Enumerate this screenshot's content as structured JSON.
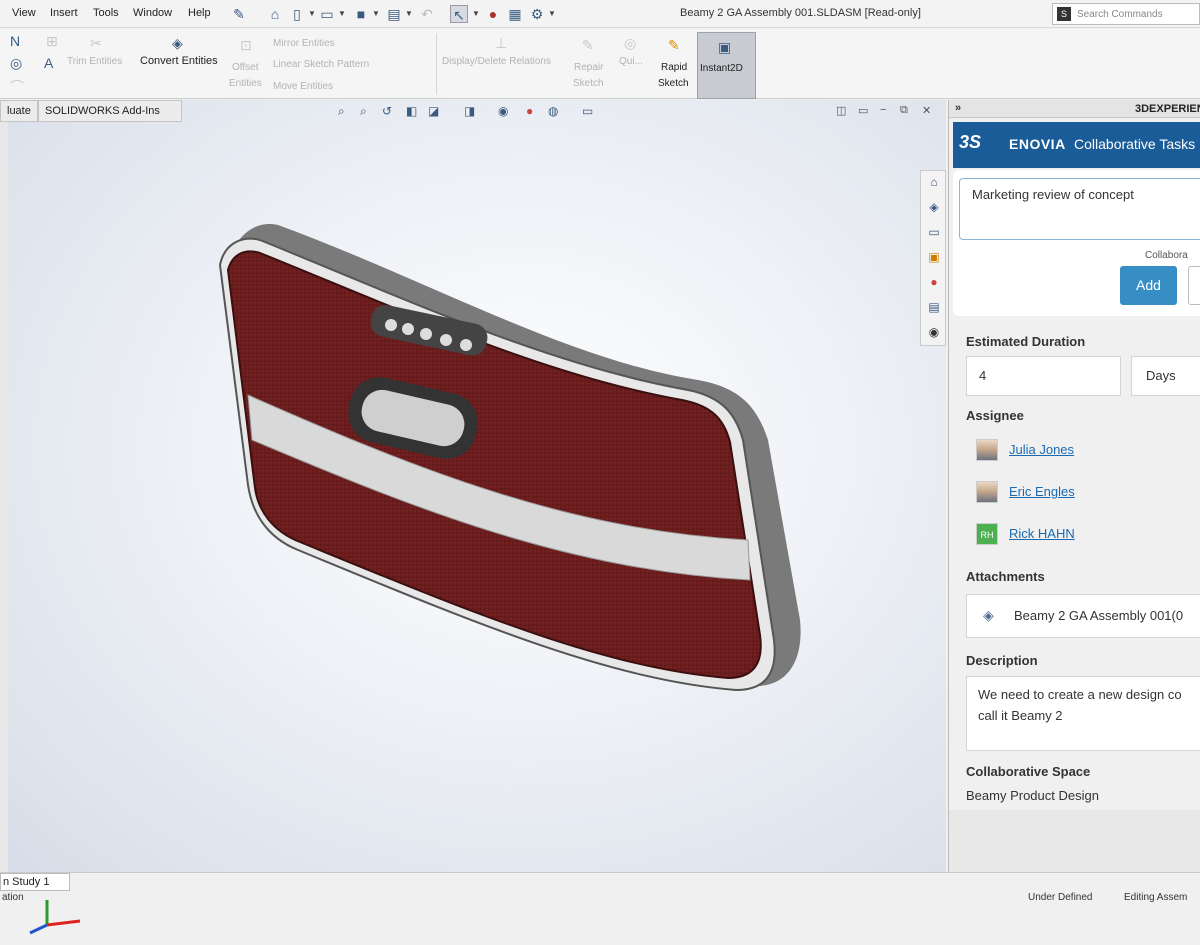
{
  "menubar": {
    "items": [
      "View",
      "Insert",
      "Tools",
      "Window",
      "Help"
    ],
    "document_title": "Beamy 2 GA Assembly 001.SLDASM [Read-only]",
    "search_placeholder": "Search Commands"
  },
  "ribbon": {
    "trim": "Trim Entities",
    "convert": "Convert Entities",
    "offset_1": "Offset",
    "offset_2": "Entities",
    "mirror": "Mirror Entities",
    "linear_pattern": "Linear Sketch Pattern",
    "move": "Move Entities",
    "display_delete": "Display/Delete Relations",
    "repair_1": "Repair",
    "repair_2": "Sketch",
    "quick": "Qui...",
    "rapid_1": "Rapid",
    "rapid_2": "Sketch",
    "instant2d": "Instant2D"
  },
  "tabs": [
    "luate",
    "SOLIDWORKS Add-Ins"
  ],
  "status": {
    "study_tab": "n Study 1",
    "left_text": "ation",
    "under_defined": "Under Defined",
    "editing": "Editing Assem"
  },
  "panel": {
    "header": "3DEXPERIEN",
    "brand": "ENOVIA",
    "app_name": "Collaborative Tasks",
    "task_title": "Marketing review of concept",
    "collab_label": "Collabora",
    "add_label": "Add",
    "duration_label": "Estimated Duration",
    "duration_value": "4",
    "duration_unit": "Days",
    "assignee_label": "Assignee",
    "assignees": [
      "Julia Jones",
      "Eric Engles",
      "Rick HAHN"
    ],
    "rh_initials": "RH",
    "attachments_label": "Attachments",
    "attachment_name": "Beamy 2 GA Assembly 001(0",
    "description_label": "Description",
    "description": "We need to create a new design co call it Beamy 2",
    "space_label": "Collaborative Space",
    "space_value": "Beamy Product Design"
  },
  "colors": {
    "enovia_blue": "#1a5c97",
    "add_button": "#368ec4",
    "link": "#1a6ab1",
    "model_body": "#6b1d1d"
  }
}
